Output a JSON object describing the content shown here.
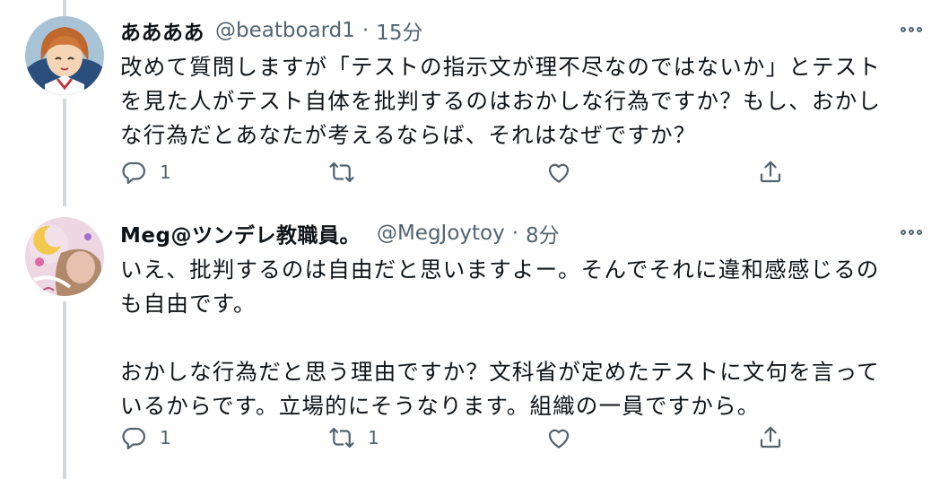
{
  "tweets": [
    {
      "display_name": "ああああ",
      "handle": "@beatboard1",
      "separator": "·",
      "time": "15分",
      "text": "改めて質問しますが「テストの指示文が理不尽なのではないか」とテスト\nを見た人がテスト自体を批判するのはおかしな行為ですか？もし、おかし\nな行為だとあなたが考えるならば、それはなぜですか？",
      "reply_count": "1",
      "retweet_count": "",
      "like_count": ""
    },
    {
      "display_name": "Meg@ツンデレ教職員。",
      "handle": "@MegJoytoy",
      "separator": "·",
      "time": "8分",
      "text": "いえ、批判するのは自由だと思いますよー。そんでそれに違和感感じるの\nも自由です。\n\nおかしな行為だと思う理由ですか？文科省が定めたテストに文句を言って\nいるからです。立場的にそうなります。組織の一員ですから。",
      "reply_count": "1",
      "retweet_count": "1",
      "like_count": ""
    }
  ],
  "icons": [
    "reply-icon",
    "retweet-icon",
    "like-icon",
    "share-icon",
    "more-icon"
  ],
  "colors": {
    "text": "#0f1419",
    "secondary": "#536471",
    "thread_line": "#cfd9de"
  }
}
